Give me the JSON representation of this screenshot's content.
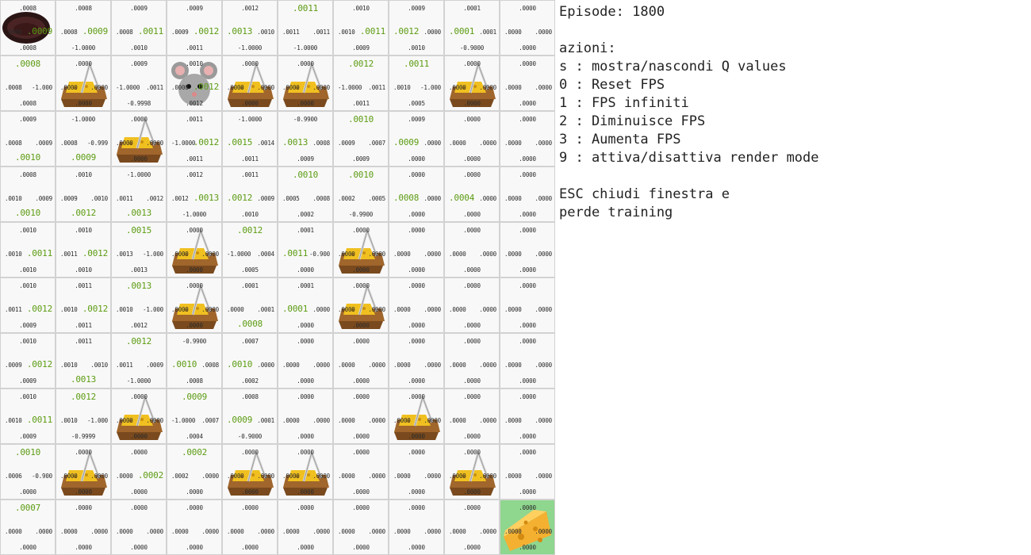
{
  "panel": {
    "episode_label": "Episode: 1800",
    "actions_title": "azioni:",
    "actions": [
      "s : mostra/nascondi Q values",
      "0 : Reset FPS",
      "1 : FPS infiniti",
      "2 : Diminuisce FPS",
      "3 : Aumenta FPS",
      "9 : attiva/disattiva render mode"
    ],
    "esc_line1": "ESC chiudi finestra e",
    "esc_line2": "perde training"
  },
  "colors": {
    "best_q": "#5c9c12",
    "goal_cell": "#8fd68f",
    "cell_bg": "#f8f8f8"
  },
  "grid": {
    "rows": 10,
    "cols": 10,
    "cells": [
      [
        {
          "up": ".0008",
          "left": ".0008",
          "right": ".0009",
          "down": ".0008",
          "best": "right",
          "item": "hole"
        },
        {
          "up": ".0008",
          "left": ".0008",
          "right": ".0009",
          "down": "-1.0000",
          "best": "right"
        },
        {
          "up": ".0009",
          "left": ".0008",
          "right": ".0011",
          "down": ".0010",
          "best": "right"
        },
        {
          "up": ".0009",
          "left": ".0009",
          "right": ".0012",
          "down": ".0011",
          "best": "right"
        },
        {
          "up": ".0012",
          "left": ".0013",
          "right": ".0010",
          "down": "-1.0000",
          "best": "left"
        },
        {
          "up": ".0011",
          "left": ".0011",
          "right": ".0011",
          "down": "-1.0000",
          "best": "up"
        },
        {
          "up": ".0010",
          "left": ".0010",
          "right": ".0011",
          "down": ".0009",
          "best": "right"
        },
        {
          "up": ".0009",
          "left": ".0012",
          "right": ".0000",
          "down": ".0010",
          "best": "left"
        },
        {
          "up": ".0001",
          "left": ".0001",
          "right": ".0001",
          "down": "-0.9000",
          "best": "left"
        },
        {
          "up": ".0000",
          "left": ".0000",
          "right": ".0000",
          "down": ".0000",
          "best": ""
        }
      ],
      [
        {
          "up": ".0008",
          "left": ".0008",
          "right": "-1.000",
          "down": ".0008",
          "best": "up"
        },
        {
          "up": ".0000",
          "left": ".0000",
          "right": ".0000",
          "down": ".0000",
          "best": "",
          "item": "trap"
        },
        {
          "up": ".0009",
          "left": "-1.0000",
          "right": ".0011",
          "down": "-0.9998",
          "best": ""
        },
        {
          "up": ".0010",
          "left": ".0000",
          "right": ".0012",
          "down": ".0012",
          "best": "right",
          "item": "mouse"
        },
        {
          "up": ".0000",
          "left": ".0000",
          "right": ".0000",
          "down": ".0000",
          "best": "",
          "item": "trap"
        },
        {
          "up": ".0000",
          "left": ".0000",
          "right": ".0000",
          "down": ".0000",
          "best": "",
          "item": "trap"
        },
        {
          "up": ".0012",
          "left": "-1.0000",
          "right": ".0011",
          "down": ".0011",
          "best": "up"
        },
        {
          "up": ".0011",
          "left": ".0010",
          "right": "-1.000",
          "down": ".0005",
          "best": "up"
        },
        {
          "up": ".0000",
          "left": ".0000",
          "right": ".0000",
          "down": ".0000",
          "best": "",
          "item": "trap"
        },
        {
          "up": ".0000",
          "left": ".0000",
          "right": ".0000",
          "down": ".0000",
          "best": ""
        }
      ],
      [
        {
          "up": ".0009",
          "left": ".0008",
          "right": ".0009",
          "down": ".0010",
          "best": "down"
        },
        {
          "up": "-1.0000",
          "left": ".0008",
          "right": "-0.999",
          "down": ".0009",
          "best": "down"
        },
        {
          "up": ".0000",
          "left": ".0000",
          "right": ".0000",
          "down": ".0000",
          "best": "",
          "item": "trap"
        },
        {
          "up": ".0011",
          "left": "-1.0000",
          "right": ".0012",
          "down": ".0011",
          "best": "right"
        },
        {
          "up": "-1.0000",
          "left": ".0015",
          "right": ".0014",
          "down": ".0011",
          "best": "left"
        },
        {
          "up": "-0.9900",
          "left": ".0013",
          "right": ".0008",
          "down": ".0009",
          "best": "left"
        },
        {
          "up": ".0010",
          "left": ".0009",
          "right": ".0007",
          "down": ".0009",
          "best": "up"
        },
        {
          "up": ".0009",
          "left": ".0009",
          "right": ".0000",
          "down": ".0000",
          "best": "left"
        },
        {
          "up": ".0000",
          "left": ".0000",
          "right": ".0000",
          "down": ".0000",
          "best": ""
        },
        {
          "up": ".0000",
          "left": ".0000",
          "right": ".0000",
          "down": ".0000",
          "best": ""
        }
      ],
      [
        {
          "up": ".0008",
          "left": ".0010",
          "right": ".0009",
          "down": ".0010",
          "best": "down"
        },
        {
          "up": ".0010",
          "left": ".0009",
          "right": ".0010",
          "down": ".0012",
          "best": "down"
        },
        {
          "up": "-1.0000",
          "left": ".0011",
          "right": ".0012",
          "down": ".0013",
          "best": "down"
        },
        {
          "up": ".0012",
          "left": ".0012",
          "right": ".0013",
          "down": "-1.0000",
          "best": "right"
        },
        {
          "up": ".0011",
          "left": ".0012",
          "right": ".0009",
          "down": ".0010",
          "best": "left"
        },
        {
          "up": ".0010",
          "left": ".0005",
          "right": ".0008",
          "down": ".0002",
          "best": "up"
        },
        {
          "up": ".0010",
          "left": ".0002",
          "right": ".0005",
          "down": "-0.9900",
          "best": "up"
        },
        {
          "up": ".0000",
          "left": ".0008",
          "right": ".0000",
          "down": ".0000",
          "best": "left"
        },
        {
          "up": ".0000",
          "left": ".0004",
          "right": ".0000",
          "down": ".0000",
          "best": "left"
        },
        {
          "up": ".0000",
          "left": ".0000",
          "right": ".0000",
          "down": ".0000",
          "best": ""
        }
      ],
      [
        {
          "up": ".0010",
          "left": ".0010",
          "right": ".0011",
          "down": ".0010",
          "best": "right"
        },
        {
          "up": ".0010",
          "left": ".0011",
          "right": ".0012",
          "down": ".0010",
          "best": "right"
        },
        {
          "up": ".0015",
          "left": ".0013",
          "right": "-1.000",
          "down": ".0013",
          "best": "up"
        },
        {
          "up": ".0000",
          "left": ".0000",
          "right": ".0000",
          "down": ".0000",
          "best": "",
          "item": "trap"
        },
        {
          "up": ".0012",
          "left": "-1.0000",
          "right": ".0004",
          "down": ".0005",
          "best": "up"
        },
        {
          "up": ".0001",
          "left": ".0011",
          "right": "-0.900",
          "down": ".0000",
          "best": "left"
        },
        {
          "up": ".0000",
          "left": ".0000",
          "right": ".0000",
          "down": ".0000",
          "best": "",
          "item": "trap"
        },
        {
          "up": ".0000",
          "left": ".0000",
          "right": ".0000",
          "down": ".0000",
          "best": ""
        },
        {
          "up": ".0000",
          "left": ".0000",
          "right": ".0000",
          "down": ".0000",
          "best": ""
        },
        {
          "up": ".0000",
          "left": ".0000",
          "right": ".0000",
          "down": ".0000",
          "best": ""
        }
      ],
      [
        {
          "up": ".0010",
          "left": ".0011",
          "right": ".0012",
          "down": ".0009",
          "best": "right"
        },
        {
          "up": ".0011",
          "left": ".0010",
          "right": ".0012",
          "down": ".0011",
          "best": "right"
        },
        {
          "up": ".0013",
          "left": ".0010",
          "right": "-1.000",
          "down": ".0012",
          "best": "up"
        },
        {
          "up": ".0000",
          "left": ".0000",
          "right": ".0000",
          "down": ".0000",
          "best": "",
          "item": "trap"
        },
        {
          "up": ".0001",
          "left": ".0000",
          "right": ".0001",
          "down": ".0008",
          "best": "down"
        },
        {
          "up": ".0001",
          "left": ".0001",
          "right": ".0000",
          "down": ".0000",
          "best": "left"
        },
        {
          "up": ".0000",
          "left": ".0000",
          "right": ".0000",
          "down": ".0000",
          "best": "",
          "item": "trap"
        },
        {
          "up": ".0000",
          "left": ".0000",
          "right": ".0000",
          "down": ".0000",
          "best": ""
        },
        {
          "up": ".0000",
          "left": ".0000",
          "right": ".0000",
          "down": ".0000",
          "best": ""
        },
        {
          "up": ".0000",
          "left": ".0000",
          "right": ".0000",
          "down": ".0000",
          "best": ""
        }
      ],
      [
        {
          "up": ".0010",
          "left": ".0009",
          "right": ".0012",
          "down": ".0009",
          "best": "right"
        },
        {
          "up": ".0011",
          "left": ".0010",
          "right": ".0010",
          "down": ".0013",
          "best": "down"
        },
        {
          "up": ".0012",
          "left": ".0011",
          "right": ".0009",
          "down": "-1.0000",
          "best": "up"
        },
        {
          "up": "-0.9900",
          "left": ".0010",
          "right": ".0008",
          "down": ".0008",
          "best": "left"
        },
        {
          "up": ".0007",
          "left": ".0010",
          "right": ".0000",
          "down": ".0002",
          "best": "left"
        },
        {
          "up": ".0000",
          "left": ".0000",
          "right": ".0000",
          "down": ".0000",
          "best": ""
        },
        {
          "up": ".0000",
          "left": ".0000",
          "right": ".0000",
          "down": ".0000",
          "best": ""
        },
        {
          "up": ".0000",
          "left": ".0000",
          "right": ".0000",
          "down": ".0000",
          "best": ""
        },
        {
          "up": ".0000",
          "left": ".0000",
          "right": ".0000",
          "down": ".0000",
          "best": ""
        },
        {
          "up": ".0000",
          "left": ".0000",
          "right": ".0000",
          "down": ".0000",
          "best": ""
        }
      ],
      [
        {
          "up": ".0010",
          "left": ".0010",
          "right": ".0011",
          "down": ".0009",
          "best": "right"
        },
        {
          "up": ".0012",
          "left": ".0010",
          "right": "-1.000",
          "down": "-0.9999",
          "best": "up"
        },
        {
          "up": ".0000",
          "left": ".0000",
          "right": ".0000",
          "down": ".0000",
          "best": "",
          "item": "trap"
        },
        {
          "up": ".0009",
          "left": "-1.0000",
          "right": ".0007",
          "down": ".0004",
          "best": "up"
        },
        {
          "up": ".0008",
          "left": ".0009",
          "right": ".0001",
          "down": "-0.9000",
          "best": "left"
        },
        {
          "up": ".0000",
          "left": ".0000",
          "right": ".0000",
          "down": ".0000",
          "best": ""
        },
        {
          "up": ".0000",
          "left": ".0000",
          "right": ".0000",
          "down": ".0000",
          "best": ""
        },
        {
          "up": ".0000",
          "left": ".0000",
          "right": ".0000",
          "down": ".0000",
          "best": "",
          "item": "trap"
        },
        {
          "up": ".0000",
          "left": ".0000",
          "right": ".0000",
          "down": ".0000",
          "best": ""
        },
        {
          "up": ".0000",
          "left": ".0000",
          "right": ".0000",
          "down": ".0000",
          "best": ""
        }
      ],
      [
        {
          "up": ".0010",
          "left": ".0006",
          "right": "-0.900",
          "down": ".0000",
          "best": "up"
        },
        {
          "up": ".0000",
          "left": ".0000",
          "right": ".0000",
          "down": ".0000",
          "best": "",
          "item": "trap"
        },
        {
          "up": ".0000",
          "left": ".0000",
          "right": ".0002",
          "down": ".0000",
          "best": "right"
        },
        {
          "up": ".0002",
          "left": ".0002",
          "right": ".0000",
          "down": ".0000",
          "best": "up"
        },
        {
          "up": ".0000",
          "left": ".0000",
          "right": ".0000",
          "down": ".0000",
          "best": "",
          "item": "trap"
        },
        {
          "up": ".0000",
          "left": ".0000",
          "right": ".0000",
          "down": ".0000",
          "best": "",
          "item": "trap"
        },
        {
          "up": ".0000",
          "left": ".0000",
          "right": ".0000",
          "down": ".0000",
          "best": ""
        },
        {
          "up": ".0000",
          "left": ".0000",
          "right": ".0000",
          "down": ".0000",
          "best": ""
        },
        {
          "up": ".0000",
          "left": ".0000",
          "right": ".0000",
          "down": ".0000",
          "best": "",
          "item": "trap"
        },
        {
          "up": ".0000",
          "left": ".0000",
          "right": ".0000",
          "down": ".0000",
          "best": ""
        }
      ],
      [
        {
          "up": ".0007",
          "left": ".0000",
          "right": ".0000",
          "down": ".0000",
          "best": "up"
        },
        {
          "up": ".0000",
          "left": ".0000",
          "right": ".0000",
          "down": ".0000",
          "best": ""
        },
        {
          "up": ".0000",
          "left": ".0000",
          "right": ".0000",
          "down": ".0000",
          "best": ""
        },
        {
          "up": ".0000",
          "left": ".0000",
          "right": ".0000",
          "down": ".0000",
          "best": ""
        },
        {
          "up": ".0000",
          "left": ".0000",
          "right": ".0000",
          "down": ".0000",
          "best": ""
        },
        {
          "up": ".0000",
          "left": ".0000",
          "right": ".0000",
          "down": ".0000",
          "best": ""
        },
        {
          "up": ".0000",
          "left": ".0000",
          "right": ".0000",
          "down": ".0000",
          "best": ""
        },
        {
          "up": ".0000",
          "left": ".0000",
          "right": ".0000",
          "down": ".0000",
          "best": ""
        },
        {
          "up": ".0000",
          "left": ".0000",
          "right": ".0000",
          "down": ".0000",
          "best": ""
        },
        {
          "up": ".0000",
          "left": ".0000",
          "right": ".0000",
          "down": ".0000",
          "best": "",
          "item": "cheese"
        }
      ]
    ]
  }
}
